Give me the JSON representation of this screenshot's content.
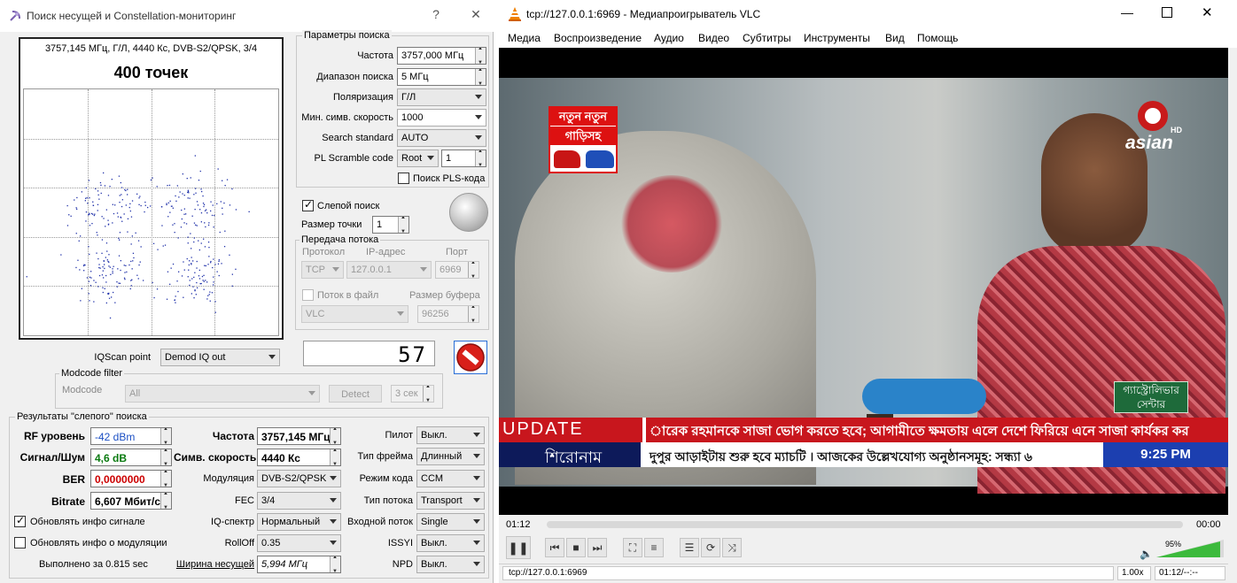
{
  "dialog": {
    "title": "Поиск несущей и Constellation-мониторинг",
    "help": "?",
    "close": "✕",
    "plot": {
      "info": "3757,145 МГц, Г/Л, 4440 Кс, DVB-S2/QPSK, 3/4",
      "points": "400 точек"
    },
    "search_params": {
      "group": "Параметры поиска",
      "freq_label": "Частота",
      "freq_value": "3757,000 МГц",
      "range_label": "Диапазон поиска",
      "range_value": "5 МГц",
      "pol_label": "Поляризация",
      "pol_value": "Г/Л",
      "minsr_label": "Мин. симв. скорость",
      "minsr_value": "1000",
      "std_label": "Search standard",
      "std_value": "AUTO",
      "pls_label": "PL Scramble code",
      "pls_mode": "Root",
      "pls_value": "1",
      "plsfind_label": "Поиск PLS-кода"
    },
    "blind": {
      "label": "Слепой поиск",
      "checked": true
    },
    "point_size": {
      "label": "Размер точки",
      "value": "1"
    },
    "stream": {
      "group": "Передача потока",
      "proto_label": "Протокол",
      "ip_label": "IP-адрес",
      "port_label": "Порт",
      "proto_value": "TCP",
      "ip_value": "127.0.0.1",
      "port_value": "6969",
      "tofile_label": "Поток в файл",
      "buf_label": "Размер буфера",
      "player_value": "VLC",
      "buf_value": "96256"
    },
    "lcd_value": "57",
    "iq": {
      "label": "IQScan point",
      "value": "Demod IQ out"
    },
    "modcode": {
      "group": "Modcode filter",
      "label": "Modcode",
      "value": "All",
      "detect": "Detect",
      "sec": "3 сек"
    },
    "results": {
      "group": "Результаты \"слепого\" поиска",
      "rf_label": "RF уровень",
      "rf_value": "-42 dBm",
      "snr_label": "Сигнал/Шум",
      "snr_value": "4,6 dB",
      "ber_label": "BER",
      "ber_value": "0,0000000",
      "bitrate_label": "Bitrate",
      "bitrate_value": "6,607 Мбит/с",
      "freq_label": "Частота",
      "freq_value": "3757,145 МГц",
      "sr_label": "Симв. скорость",
      "sr_value": "4440 Кс",
      "mod_label": "Модуляция",
      "mod_value": "DVB-S2/QPSK",
      "fec_label": "FEC",
      "fec_value": "3/4",
      "iqs_label": "IQ-спектр",
      "iqs_value": "Нормальный",
      "rolloff_label": "RollOff",
      "rolloff_value": "0.35",
      "bw_label": "Ширина несущей",
      "bw_value": "5,994 МГц",
      "pilot_label": "Пилот",
      "pilot_value": "Выкл.",
      "frame_label": "Тип фрейма",
      "frame_value": "Длинный",
      "ccm_label": "Режим кода",
      "ccm_value": "CCM",
      "stype_label": "Тип потока",
      "stype_value": "Transport",
      "istream_label": "Входной поток",
      "istream_value": "Single",
      "issyi_label": "ISSYI",
      "issyi_value": "Выкл.",
      "npd_label": "NPD",
      "npd_value": "Выкл.",
      "upd_sig_label": "Обновлять инфо сигнале",
      "upd_mod_label": "Обновлять инфо о модуляции",
      "done": "Выполнено за 0.815 sec"
    }
  },
  "vlc": {
    "title": "tcp://127.0.0.1:6969 - Медиапроигрыватель VLC",
    "menu": [
      "Медиа",
      "Воспроизведение",
      "Аудио",
      "Видео",
      "Субтитры",
      "Инструменты",
      "Вид",
      "Помощь"
    ],
    "promo_top": "নতুন নতুন",
    "promo_bottom": "গাড়িসহ",
    "logo": "asian",
    "logo_hd": "HD",
    "caption": "গ্যাস্ট্রোলিভার সেন্টার",
    "update_label": "UPDATE",
    "ticker1": "ারেক রহমানকে সাজা ভোগ করতে হবে; আগামীতে ক্ষমতায় এলে দেশে ফিরিয়ে এনে সাজা কার্যকর কর",
    "headline_label": "শিরোনাম",
    "ticker2": "দুপুর আড়াইটায় শুরু হবে ম্যাচটি । আজকের উল্লেখযোগ্য অনুষ্ঠানসমূহ: সন্ধ্যা ৬",
    "clock": "9:25 PM",
    "time_elapsed": "01:12",
    "time_total": "00:00",
    "volume": "95%",
    "status_url": "tcp://127.0.0.1:6969",
    "speed": "1.00x",
    "status_time": "01:12/--:--"
  },
  "colors": {
    "ticker_red": "#c8161d",
    "ticker_navy": "#0d1a5a",
    "clock_blue": "#1c3fb0",
    "vol_green": "#3cba3c"
  }
}
